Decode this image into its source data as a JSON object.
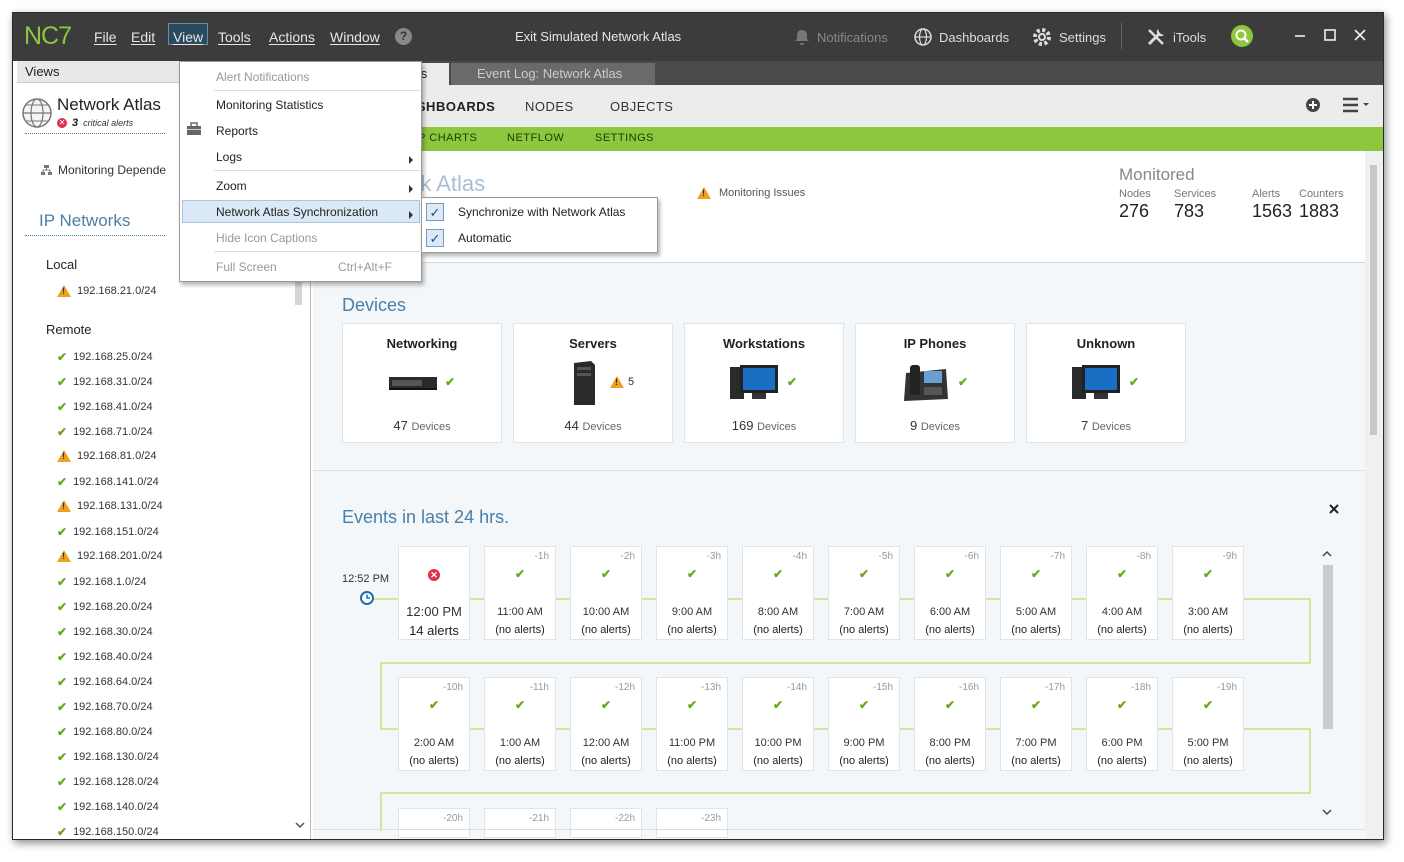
{
  "app": {
    "logo": "NC7",
    "window_title": "Exit Simulated Network Atlas"
  },
  "menubar": [
    "File",
    "Edit",
    "View",
    "Tools",
    "Actions",
    "Window"
  ],
  "help": "?",
  "toolbar": {
    "notifications": "Notifications",
    "dashboards": "Dashboards",
    "settings": "Settings",
    "itools": "iTools"
  },
  "views_panel": {
    "title": "Views",
    "atlas_name": "Network Atlas",
    "critical_count": "3",
    "critical_label": "critical alerts",
    "monitoring_dep": "Monitoring Depende",
    "ip_networks": "IP Networks",
    "local_label": "Local",
    "local": [
      {
        "ip": "192.168.21.0/24",
        "status": "warning"
      }
    ],
    "remote_label": "Remote",
    "remote": [
      {
        "ip": "192.168.25.0/24",
        "status": "ok"
      },
      {
        "ip": "192.168.31.0/24",
        "status": "ok"
      },
      {
        "ip": "192.168.41.0/24",
        "status": "ok"
      },
      {
        "ip": "192.168.71.0/24",
        "status": "ok"
      },
      {
        "ip": "192.168.81.0/24",
        "status": "warning"
      },
      {
        "ip": "192.168.141.0/24",
        "status": "ok"
      },
      {
        "ip": "192.168.131.0/24",
        "status": "warning"
      },
      {
        "ip": "192.168.151.0/24",
        "status": "ok"
      },
      {
        "ip": "192.168.201.0/24",
        "status": "warning"
      },
      {
        "ip": "192.168.1.0/24",
        "status": "ok"
      },
      {
        "ip": "192.168.20.0/24",
        "status": "ok"
      },
      {
        "ip": "192.168.30.0/24",
        "status": "ok"
      },
      {
        "ip": "192.168.40.0/24",
        "status": "ok"
      },
      {
        "ip": "192.168.64.0/24",
        "status": "ok"
      },
      {
        "ip": "192.168.70.0/24",
        "status": "ok"
      },
      {
        "ip": "192.168.80.0/24",
        "status": "ok"
      },
      {
        "ip": "192.168.130.0/24",
        "status": "ok"
      },
      {
        "ip": "192.168.128.0/24",
        "status": "ok"
      },
      {
        "ip": "192.168.140.0/24",
        "status": "ok"
      },
      {
        "ip": "192.168.150.0/24",
        "status": "ok"
      }
    ]
  },
  "tabs": {
    "active": "tlas",
    "event_log": "Event Log: Network Atlas"
  },
  "nav": {
    "dashboards": "ASHBOARDS",
    "nodes": "NODES",
    "objects": "OBJECTS"
  },
  "subnav": {
    "top_charts": "OP CHARTS",
    "netflow": "NETFLOW",
    "settings": "SETTINGS"
  },
  "overview": {
    "title_fragment": "rk Atlas",
    "monitoring_issues": "Monitoring Issues",
    "monitored_label": "Monitored",
    "stats": [
      {
        "label": "Nodes",
        "value": "276"
      },
      {
        "label": "Services",
        "value": "783"
      },
      {
        "label": "Alerts",
        "value": "1563"
      },
      {
        "label": "Counters",
        "value": "1883"
      }
    ]
  },
  "devices": {
    "title": "Devices",
    "unit": "Devices",
    "cards": [
      {
        "name": "Networking",
        "count": "47",
        "status": "ok",
        "warn_count": ""
      },
      {
        "name": "Servers",
        "count": "44",
        "status": "warning",
        "warn_count": "5"
      },
      {
        "name": "Workstations",
        "count": "169",
        "status": "ok",
        "warn_count": ""
      },
      {
        "name": "IP Phones",
        "count": "9",
        "status": "ok",
        "warn_count": ""
      },
      {
        "name": "Unknown",
        "count": "7",
        "status": "ok",
        "warn_count": ""
      }
    ]
  },
  "events": {
    "title": "Events in last 24 hrs.",
    "now": "12:52 PM",
    "row1": [
      {
        "offset": "",
        "time": "12:00 PM",
        "alerts": "14 alerts",
        "status": "error"
      },
      {
        "offset": "-1h",
        "time": "11:00 AM",
        "alerts": "(no alerts)",
        "status": "ok"
      },
      {
        "offset": "-2h",
        "time": "10:00 AM",
        "alerts": "(no alerts)",
        "status": "ok"
      },
      {
        "offset": "-3h",
        "time": "9:00 AM",
        "alerts": "(no alerts)",
        "status": "ok"
      },
      {
        "offset": "-4h",
        "time": "8:00 AM",
        "alerts": "(no alerts)",
        "status": "ok"
      },
      {
        "offset": "-5h",
        "time": "7:00 AM",
        "alerts": "(no alerts)",
        "status": "ok"
      },
      {
        "offset": "-6h",
        "time": "6:00 AM",
        "alerts": "(no alerts)",
        "status": "ok"
      },
      {
        "offset": "-7h",
        "time": "5:00 AM",
        "alerts": "(no alerts)",
        "status": "ok"
      },
      {
        "offset": "-8h",
        "time": "4:00 AM",
        "alerts": "(no alerts)",
        "status": "ok"
      },
      {
        "offset": "-9h",
        "time": "3:00 AM",
        "alerts": "(no alerts)",
        "status": "ok"
      }
    ],
    "row2": [
      {
        "offset": "-10h",
        "time": "2:00 AM",
        "alerts": "(no alerts)",
        "status": "ok"
      },
      {
        "offset": "-11h",
        "time": "1:00 AM",
        "alerts": "(no alerts)",
        "status": "ok"
      },
      {
        "offset": "-12h",
        "time": "12:00 AM",
        "alerts": "(no alerts)",
        "status": "ok"
      },
      {
        "offset": "-13h",
        "time": "11:00 PM",
        "alerts": "(no alerts)",
        "status": "ok"
      },
      {
        "offset": "-14h",
        "time": "10:00 PM",
        "alerts": "(no alerts)",
        "status": "ok"
      },
      {
        "offset": "-15h",
        "time": "9:00 PM",
        "alerts": "(no alerts)",
        "status": "ok"
      },
      {
        "offset": "-16h",
        "time": "8:00 PM",
        "alerts": "(no alerts)",
        "status": "ok"
      },
      {
        "offset": "-17h",
        "time": "7:00 PM",
        "alerts": "(no alerts)",
        "status": "ok"
      },
      {
        "offset": "-18h",
        "time": "6:00 PM",
        "alerts": "(no alerts)",
        "status": "ok"
      },
      {
        "offset": "-19h",
        "time": "5:00 PM",
        "alerts": "(no alerts)",
        "status": "ok"
      }
    ],
    "row3": [
      "-20h",
      "-21h",
      "-22h",
      "-23h"
    ]
  },
  "view_menu": {
    "alert_notifications": "Alert Notifications",
    "monitoring_statistics": "Monitoring Statistics",
    "reports": "Reports",
    "logs": "Logs",
    "zoom": "Zoom",
    "sync": "Network Atlas Synchronization",
    "hide_captions": "Hide Icon Captions",
    "full_screen": "Full Screen",
    "full_screen_shortcut": "Ctrl+Alt+F"
  },
  "sync_submenu": {
    "sync_with": "Synchronize with Network Atlas",
    "automatic": "Automatic"
  },
  "colors": {
    "accent": "#8dc63f",
    "titlebar": "#3c3c3c",
    "heading": "#4a7fa8",
    "warning": "#f0a020",
    "error": "#e0304a"
  }
}
